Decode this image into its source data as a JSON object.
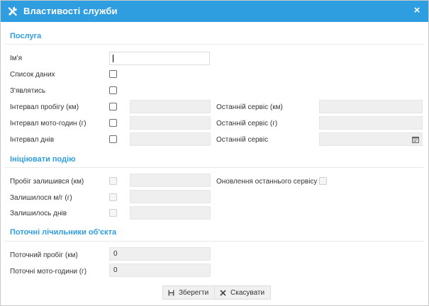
{
  "dialog": {
    "title": "Властивості служби",
    "close_glyph": "×",
    "title_icon": "tools-icon"
  },
  "sections": {
    "service": "Послуга",
    "trigger": "Ініціювати подію",
    "counters": "Поточні лічильники об'єкта"
  },
  "service": {
    "name_label": "Ім'я",
    "name_value": "",
    "data_list_label": "Список даних",
    "show_label": "З'являтись",
    "mileage_interval_label": "Інтервал пробігу (км)",
    "engine_hours_interval_label": "Інтервал мото-годин (г)",
    "days_interval_label": "Інтервал днів",
    "last_service_km_label": "Останній сервіс (км)",
    "last_service_h_label": "Останній сервіс (г)",
    "last_service_label": "Останній сервіс"
  },
  "trigger": {
    "mileage_left_label": "Пробіг залишився (км)",
    "hours_left_label": "Залишилося м/г (г)",
    "days_left_label": "Залишилось днів",
    "update_last_service_label": "Оновлення останнього сервісу"
  },
  "counters": {
    "current_mileage_label": "Поточний пробіг (км)",
    "current_mileage_value": "0",
    "current_hours_label": "Поточні мото-години (г)",
    "current_hours_value": "0"
  },
  "buttons": {
    "save": "Зберегти",
    "cancel": "Скасувати"
  },
  "colors": {
    "accent": "#2f9ee0",
    "field_bg": "#efefef"
  }
}
